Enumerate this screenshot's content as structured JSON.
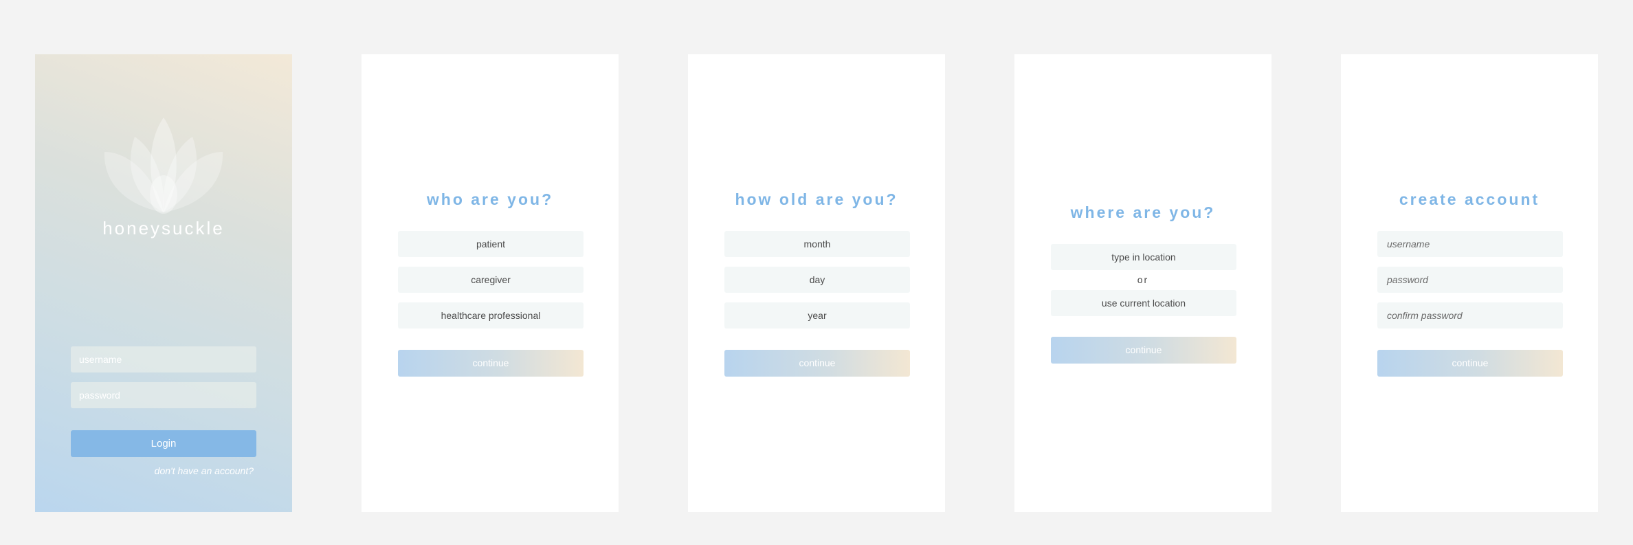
{
  "login": {
    "brand": "honeysuckle",
    "username_placeholder": "username",
    "password_placeholder": "password",
    "login_label": "Login",
    "signup_link": "don't have an account?"
  },
  "who": {
    "title": "who are you?",
    "options": [
      "patient",
      "caregiver",
      "healthcare professional"
    ],
    "continue_label": "continue"
  },
  "age": {
    "title": "how old are you?",
    "fields": [
      "month",
      "day",
      "year"
    ],
    "continue_label": "continue"
  },
  "location": {
    "title": "where are you?",
    "type_location": "type in location",
    "or_label": "or",
    "use_current": "use current location",
    "continue_label": "continue"
  },
  "account": {
    "title": "create account",
    "username_placeholder": "username",
    "password_placeholder": "password",
    "confirm_placeholder": "confirm password",
    "continue_label": "continue"
  },
  "colors": {
    "accent": "#7fb6e6",
    "login_button": "#85b8e6",
    "background": "#f3f3f3",
    "option_bg": "#f3f7f7"
  },
  "icons": {
    "logo": "lotus-logo-icon"
  }
}
